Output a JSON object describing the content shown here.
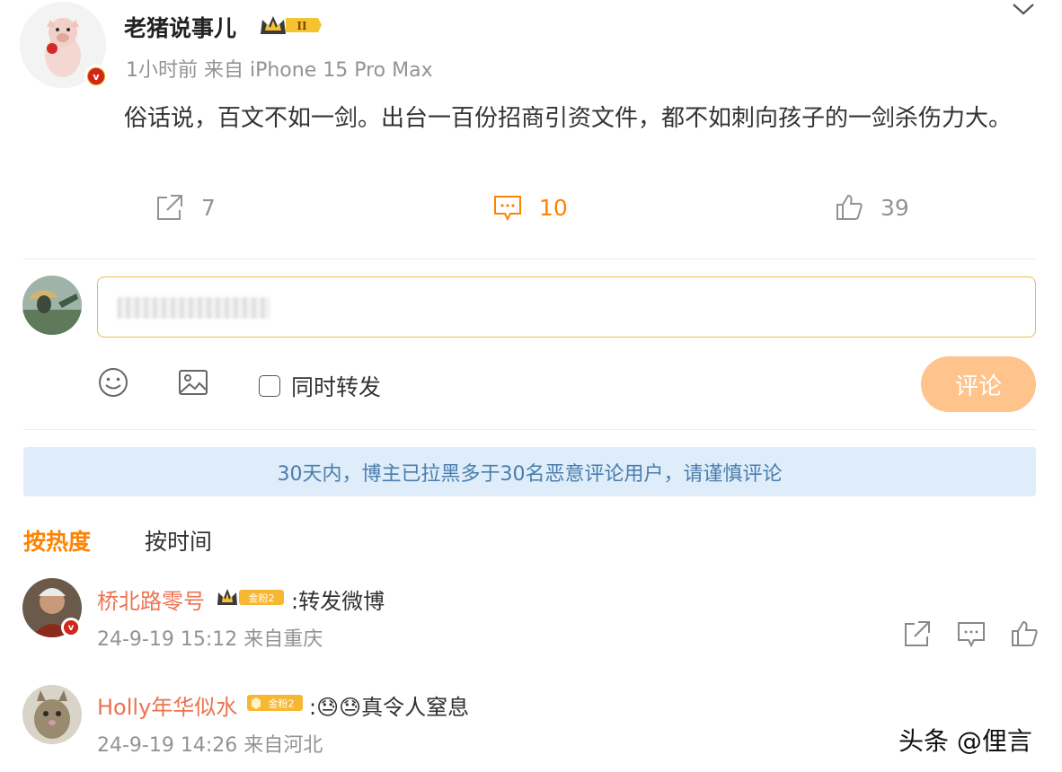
{
  "post": {
    "author": "老猪说事儿",
    "level_badge": "II",
    "meta": "1小时前 来自 iPhone 15 Pro Max",
    "body": "俗话说，百文不如一剑。出台一百份招商引资文件，都不如刺向孩子的一剑杀伤力大。",
    "actions": {
      "repost_count": "7",
      "comment_count": "10",
      "like_count": "39"
    }
  },
  "composer": {
    "repost_label": "同时转发",
    "submit_label": "评论"
  },
  "notice": "30天内，博主已拉黑多于30名恶意评论用户，请谨慎评论",
  "sort": {
    "hot_label": "按热度",
    "time_label": "按时间"
  },
  "comments": [
    {
      "name": "桥北路零号",
      "badge": "金粉2",
      "text": ":转发微博",
      "meta": "24-9-19 15:12 来自重庆"
    },
    {
      "name": "Holly年华似水",
      "badge": "金粉2",
      "text": ":😓😓真令人窒息",
      "meta": "24-9-19 14:26 来自河北"
    }
  ],
  "watermark": "头条 @俚言",
  "colors": {
    "accent": "#ff8200",
    "name": "#eb7350",
    "meta": "#939393",
    "notice_bg": "#deedf9",
    "notice_text": "#4a7dad",
    "submit_bg": "#ffc38c"
  },
  "icons": [
    "chevron-down-icon",
    "repost-icon",
    "comment-icon",
    "like-icon",
    "emoji-icon",
    "image-icon",
    "verified-icon",
    "crown-icon"
  ]
}
